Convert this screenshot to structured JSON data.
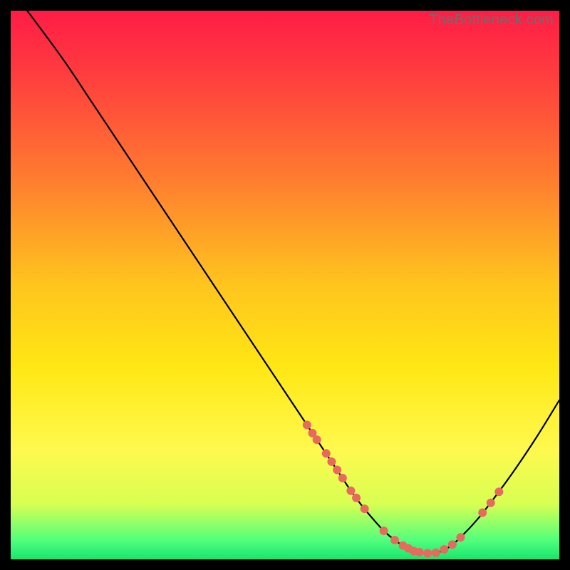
{
  "watermark": "TheBottleneck.com",
  "chart_data": {
    "type": "line",
    "title": "",
    "xlabel": "",
    "ylabel": "",
    "xlim": [
      0,
      100
    ],
    "ylim": [
      0,
      100
    ],
    "background_gradient": {
      "stops": [
        {
          "offset": 0.0,
          "color": "#ff1c46"
        },
        {
          "offset": 0.12,
          "color": "#ff3e3e"
        },
        {
          "offset": 0.3,
          "color": "#ff7a30"
        },
        {
          "offset": 0.5,
          "color": "#ffc51e"
        },
        {
          "offset": 0.65,
          "color": "#ffe714"
        },
        {
          "offset": 0.8,
          "color": "#fff94e"
        },
        {
          "offset": 0.9,
          "color": "#d7ff52"
        },
        {
          "offset": 0.965,
          "color": "#52ff7c"
        },
        {
          "offset": 1.0,
          "color": "#17e66e"
        }
      ]
    },
    "series": [
      {
        "name": "bottleneck-curve",
        "color": "#000000",
        "x": [
          3,
          6,
          10,
          15,
          20,
          25,
          30,
          35,
          40,
          45,
          50,
          55,
          58,
          60,
          62,
          64,
          66,
          68,
          70,
          72,
          74,
          76,
          78,
          80,
          82,
          85,
          88,
          92,
          96,
          100
        ],
        "y": [
          100,
          96,
          90.5,
          83,
          75.5,
          68,
          60.5,
          53,
          45.5,
          38,
          30.5,
          23,
          18.5,
          15.5,
          12.5,
          9.8,
          7.4,
          5.2,
          3.5,
          2.2,
          1.4,
          1.1,
          1.3,
          2.3,
          4.0,
          7.2,
          11.0,
          16.5,
          22.5,
          29.0
        ]
      }
    ],
    "scatter": [
      {
        "name": "curve-markers",
        "color": "#e86a5e",
        "radius": 6,
        "points": [
          {
            "x": 54.0,
            "y": 24.5
          },
          {
            "x": 55.0,
            "y": 23.0
          },
          {
            "x": 55.8,
            "y": 21.8
          },
          {
            "x": 57.5,
            "y": 19.3
          },
          {
            "x": 58.5,
            "y": 17.8
          },
          {
            "x": 59.5,
            "y": 16.3
          },
          {
            "x": 60.5,
            "y": 14.8
          },
          {
            "x": 62.0,
            "y": 12.5
          },
          {
            "x": 63.0,
            "y": 11.2
          },
          {
            "x": 64.5,
            "y": 9.2
          },
          {
            "x": 68.0,
            "y": 5.2
          },
          {
            "x": 70.0,
            "y": 3.5
          },
          {
            "x": 71.5,
            "y": 2.5
          },
          {
            "x": 72.5,
            "y": 2.0
          },
          {
            "x": 73.5,
            "y": 1.5
          },
          {
            "x": 74.5,
            "y": 1.3
          },
          {
            "x": 76.0,
            "y": 1.1
          },
          {
            "x": 77.5,
            "y": 1.2
          },
          {
            "x": 79.0,
            "y": 1.8
          },
          {
            "x": 80.5,
            "y": 2.7
          },
          {
            "x": 82.0,
            "y": 4.0
          },
          {
            "x": 86.0,
            "y": 8.5
          },
          {
            "x": 87.5,
            "y": 10.3
          },
          {
            "x": 89.0,
            "y": 12.3
          }
        ]
      }
    ]
  }
}
